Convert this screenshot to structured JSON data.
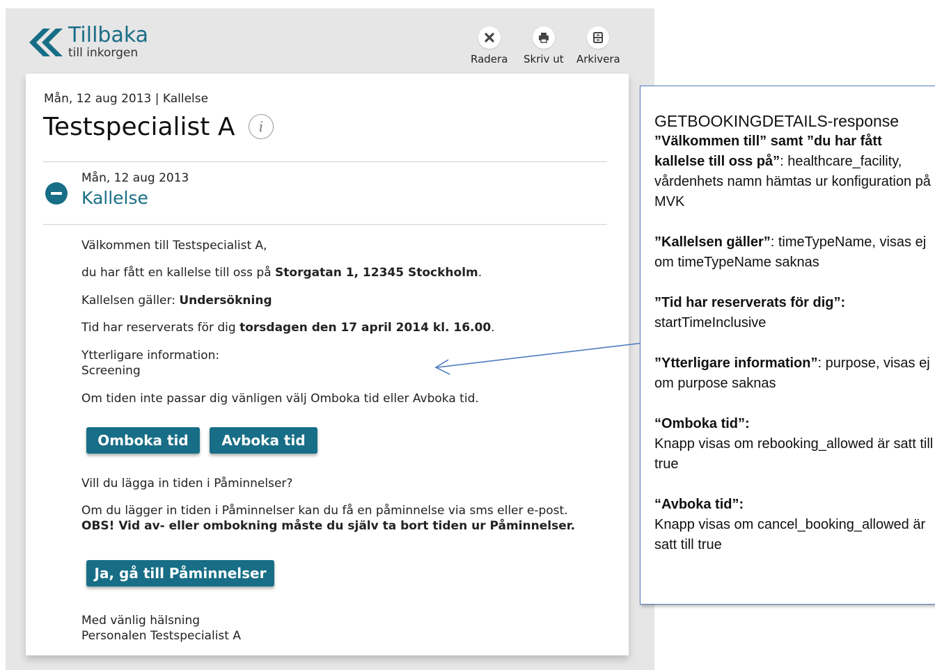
{
  "header": {
    "back_title": "Tillbaka",
    "back_subtitle": "till inkorgen",
    "back_icon": "double-chevron-left-icon",
    "actions": [
      {
        "label": "Radera",
        "icon": "close-icon"
      },
      {
        "label": "Skriv ut",
        "icon": "print-icon"
      },
      {
        "label": "Arkivera",
        "icon": "archive-icon"
      }
    ]
  },
  "message": {
    "meta": "Mån, 12 aug 2013 | Kallelse",
    "title": "Testspecialist A",
    "info_icon_glyph": "i",
    "date": "Mån, 12 aug 2013",
    "subject": "Kallelse",
    "welcome": "Välkommen till Testspecialist A,",
    "location_prefix": "du har fått en kallelse till oss på ",
    "location": "Storgatan 1, 12345 Stockholm",
    "location_suffix": ".",
    "type_prefix": "Kallelsen gäller: ",
    "type": "Undersökning",
    "time_prefix": "Tid har reserverats för dig ",
    "time": "torsdagen den 17 april 2014 kl. 16.00",
    "time_suffix": ".",
    "extra_label": "Ytterligare information:",
    "extra_value": "Screening",
    "reschedule_text": "Om tiden inte passar dig vänligen välj Omboka tid eller Avboka tid.",
    "rebook_button": "Omboka tid",
    "cancel_button": "Avboka tid",
    "reminder_question": "Vill du lägga in tiden i Påminnelser?",
    "reminder_info": "Om du lägger in tiden i Påminnelser kan du få en påminnelse via sms eller e-post.",
    "reminder_warning": "OBS! Vid av- eller ombokning måste du själv ta bort tiden ur Påminnelser.",
    "reminder_button": "Ja, gå till Påminnelser",
    "closing": "Med vänlig hälsning",
    "signature": "Personalen Testspecialist A"
  },
  "annotation": {
    "title": "GETBOOKINGDETAILS-response",
    "sections": [
      {
        "label": "”Välkommen till” samt ”du har fått kallelse till oss på”",
        "text": ": healthcare_facility, vårdenhets namn hämtas ur konfiguration på MVK"
      },
      {
        "label": "”Kallelsen gäller”",
        "text": ": timeTypeName, visas ej om timeTypeName saknas"
      },
      {
        "label": "”Tid har reserverats för dig”:",
        "text": "startTimeInclusive"
      },
      {
        "label": "”Ytterligare information”",
        "text": ": purpose, visas ej om purpose saknas"
      },
      {
        "label": "“Omboka tid”:",
        "text": "Knapp visas om rebooking_allowed är satt till true"
      },
      {
        "label": "“Avboka tid”:",
        "text": "Knapp visas om cancel_booking_allowed är satt till true"
      }
    ]
  },
  "colors": {
    "accent": "#176e86",
    "panel_bg": "#e6e6e6",
    "note_border": "#4f7cbf"
  }
}
